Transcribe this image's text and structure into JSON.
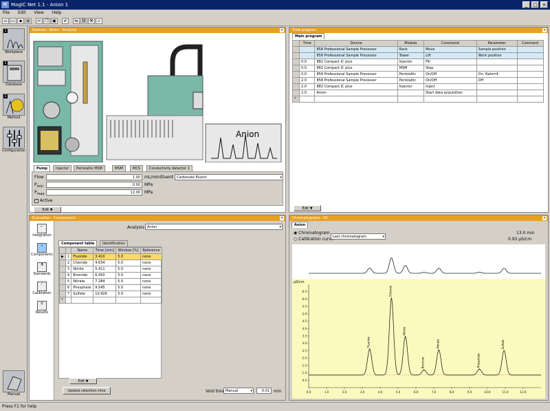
{
  "window": {
    "title": "MagIC Net 1.1 - Anion 1"
  },
  "menu": [
    "File",
    "Edit",
    "View",
    "Help"
  ],
  "sidebar": {
    "items": [
      {
        "label": "Workplace",
        "num": "1"
      },
      {
        "label": "Database",
        "num": "1"
      },
      {
        "label": "Method",
        "num": "1"
      },
      {
        "label": "Configuration",
        "num": ""
      }
    ],
    "manual": "Manual"
  },
  "devices_panel": {
    "title": "Devices - Anion - Analysis",
    "anion_label": "Anion",
    "tabs": [
      "Pump",
      "Injector",
      "Peristaltic MSM",
      "MSM",
      "MCS",
      "Conductivity detector 1"
    ],
    "pump": {
      "flow_label": "Flow",
      "flow_value": "1.00",
      "flow_unit": "mL/min",
      "pmin_label": "P",
      "pmin_sub": "min",
      "pmin_value": "0.00",
      "pmin_unit": "MPa",
      "pmax_label": "P",
      "pmax_sub": "max",
      "pmax_value": "12.00",
      "pmax_unit": "MPa",
      "eluent_label": "Eluent",
      "eluent_value": "Carbonate Eluent",
      "active_label": "Active"
    },
    "edit_button": "Edit ▼"
  },
  "timeprog": {
    "title": "Time program",
    "tab": "Main program",
    "headers": [
      "Time",
      "Device",
      "Module",
      "Command",
      "Parameter",
      "Comment"
    ],
    "rows": [
      [
        "",
        "858 Professional Sample Processor",
        "Rack",
        "Move",
        "Sample position",
        ""
      ],
      [
        "",
        "858 Professional Sample Processor",
        "Tower",
        "Lift",
        "Work position",
        ""
      ],
      [
        "0.0",
        "882 Compact IC plus",
        "Injector",
        "Fill",
        "",
        ""
      ],
      [
        "0.0",
        "882 Compact IC plus",
        "MSM",
        "Step",
        "",
        ""
      ],
      [
        "0.0",
        "858 Professional Sample Processor",
        "Peristaltic",
        "On/Off",
        "On, Rate=4",
        ""
      ],
      [
        "2.0",
        "858 Professional Sample Processor",
        "Peristaltic",
        "On/Off",
        "Off",
        ""
      ],
      [
        "2.0",
        "882 Compact IC plus",
        "Injector",
        "Inject",
        "",
        ""
      ],
      [
        "2.0",
        "Anion",
        "",
        "Start data acquisition",
        "",
        ""
      ]
    ],
    "edit_button": "Edit ▼"
  },
  "evaluation": {
    "title": "Evaluation - Components",
    "nav": [
      "Integration",
      "Components",
      "Standards",
      "Calibration",
      "Results"
    ],
    "analysis_label": "Analysis",
    "analysis_value": "Anion",
    "tabs": [
      "Component table",
      "Identification"
    ],
    "headers": [
      "",
      "Name",
      "Time [min]",
      "Window [%]",
      "Reference"
    ],
    "rows": [
      [
        "1",
        "Fluoride",
        "3.410",
        "5.0",
        "none"
      ],
      [
        "2",
        "Chloride",
        "4.634",
        "5.0",
        "none"
      ],
      [
        "3",
        "Nitrite",
        "5.411",
        "5.0",
        "none"
      ],
      [
        "4",
        "Bromide",
        "6.450",
        "5.0",
        "none"
      ],
      [
        "5",
        "Nitrate",
        "7.284",
        "5.0",
        "none"
      ],
      [
        "6",
        "Phosphate",
        "9.545",
        "5.0",
        "none"
      ],
      [
        "7",
        "Sulfate",
        "10.926",
        "5.0",
        "none"
      ]
    ],
    "edit_button": "Edit ▼",
    "update_button": "Update retention time",
    "void_label": "Void time",
    "void_mode": "Manual",
    "void_value": "0.01",
    "void_unit": "min"
  },
  "chromatogram": {
    "title": "Chromatograms - 63",
    "tab": "Anion",
    "radio1": "Chromatogram",
    "radio2": "Calibration curve",
    "select_value": "Last chromatogram",
    "info1": "13.0 min",
    "info2": "0.93 µS/cm",
    "yunit": "µS/cm",
    "peak_labels": [
      "Fluoride",
      "Chloride",
      "Nitrite",
      "Bromide",
      "Nitrate",
      "Phosphate",
      "Sulfate"
    ]
  },
  "chart_data": {
    "type": "line",
    "xlabel": "",
    "ylabel": "µS/cm",
    "xlim": [
      0,
      13
    ],
    "ylim": [
      0,
      7
    ],
    "xticks": [
      "0.0",
      "1.0",
      "2.0",
      "3.0",
      "4.0",
      "5.0",
      "6.0",
      "7.0",
      "8.0",
      "9.0",
      "10.0",
      "11.0",
      "12.0"
    ],
    "yticks": [
      "0.5",
      "1.0",
      "1.5",
      "2.0",
      "2.5",
      "3.0",
      "3.5",
      "4.0",
      "4.5",
      "5.0",
      "5.5",
      "6.0",
      "6.5"
    ],
    "baseline": 0.85,
    "peaks": [
      {
        "name": "Fluoride",
        "x": 3.41,
        "y": 2.6
      },
      {
        "name": "Chloride",
        "x": 4.63,
        "y": 6.05
      },
      {
        "name": "Nitrite",
        "x": 5.41,
        "y": 3.45
      },
      {
        "name": "Bromide",
        "x": 6.45,
        "y": 1.2
      },
      {
        "name": "Nitrate",
        "x": 7.28,
        "y": 2.55
      },
      {
        "name": "Phosphate",
        "x": 9.55,
        "y": 1.25
      },
      {
        "name": "Sulfate",
        "x": 10.93,
        "y": 2.5
      }
    ]
  },
  "status": "Press F1 for help"
}
